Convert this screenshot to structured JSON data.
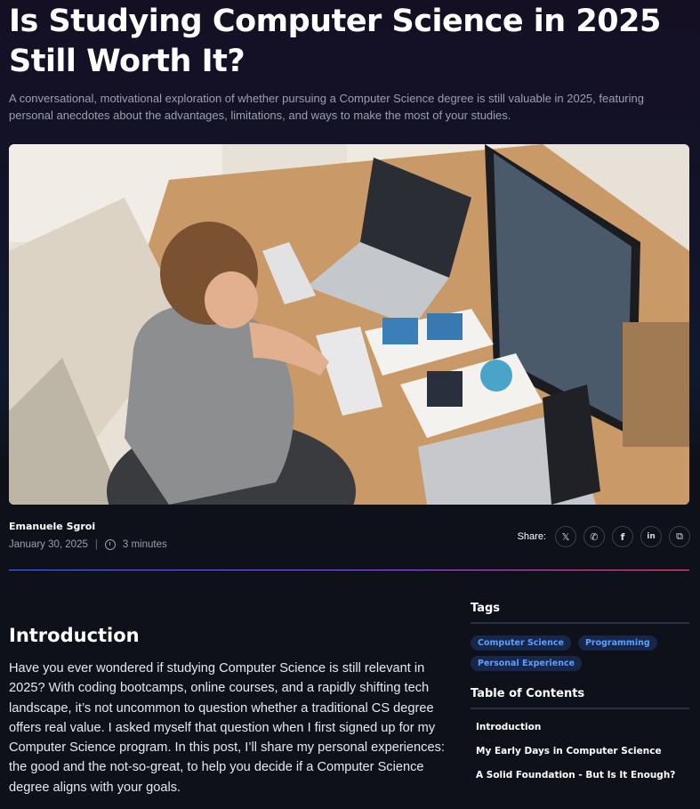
{
  "article": {
    "title": "Is Studying Computer Science in 2025 Still Worth It?",
    "subtitle": "A conversational, motivational exploration of whether pursuing a Computer Science degree is still valuable in 2025, featuring personal anecdotes about the advantages, limitations, and ways to make the most of your studies.",
    "author": "Emanuele Sgroi",
    "date": "January 30, 2025",
    "separator": "|",
    "read_time": "3 minutes",
    "section_heading": "Introduction",
    "intro_paragraph": "Have you ever wondered if studying Computer Science is still relevant in 2025? With coding bootcamps, online courses, and a rapidly shifting tech landscape, it’s not uncommon to question whether a traditional CS degree offers real value. I asked myself that question when I first signed up for my Computer Science program. In this post, I’ll share my personal experiences: the good and the not-so-great, to help you decide if a Computer Science degree aligns with your goals."
  },
  "share": {
    "label": "Share:",
    "buttons": [
      {
        "icon": "x-icon",
        "glyph": "𝕏"
      },
      {
        "icon": "whatsapp-icon",
        "glyph": "✆"
      },
      {
        "icon": "facebook-icon",
        "glyph": "f"
      },
      {
        "icon": "linkedin-icon",
        "glyph": "in"
      },
      {
        "icon": "copy-icon",
        "glyph": "⧉"
      }
    ]
  },
  "sidebar": {
    "tags_heading": "Tags",
    "tags": [
      "Computer Science",
      "Programming",
      "Personal Experience"
    ],
    "toc_heading": "Table of Contents",
    "toc": [
      "Introduction",
      "My Early Days in Computer Science",
      "A Solid Foundation - But Is It Enough?"
    ]
  },
  "colors": {
    "background": "#0e111a",
    "tag_text": "#5aa0ff",
    "tag_bg": "#18264a",
    "divider_gradient": [
      "#4f6ef2",
      "#9b5cf0",
      "#e95b8c"
    ]
  }
}
